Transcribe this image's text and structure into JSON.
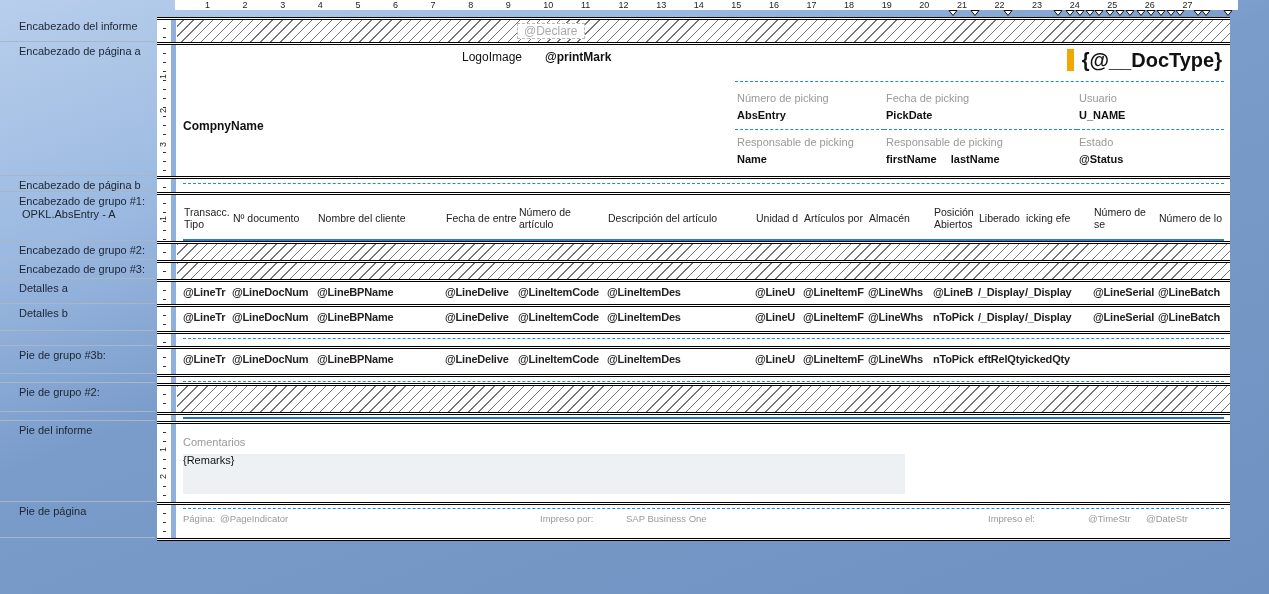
{
  "ruler": [
    "1",
    "2",
    "3",
    "4",
    "5",
    "6",
    "7",
    "8",
    "9",
    "10",
    "11",
    "12",
    "13",
    "14",
    "15",
    "16",
    "17",
    "18",
    "19",
    "20",
    "21",
    "22",
    "23",
    "24",
    "25",
    "26",
    "27"
  ],
  "sections": [
    {
      "label": "Encabezado del informe",
      "kind": "hatched",
      "field": "@Declare"
    },
    {
      "label": "Encabezado de página a",
      "kind": "page_header",
      "ruler": [
        "1",
        "2",
        "3"
      ],
      "logo": "LogoImage",
      "print_mark": "@printMark",
      "doc_type": "{@__DocType}",
      "company": "CompnyName",
      "info": [
        {
          "label": "Número de picking",
          "values": [
            "AbsEntry"
          ]
        },
        {
          "label": "Fecha de picking",
          "values": [
            "PickDate"
          ]
        },
        {
          "label": "Usuario",
          "values": [
            "U_NAME"
          ]
        },
        {
          "label": "Responsable de picking",
          "values": [
            "Name"
          ]
        },
        {
          "label": "Responsable de picking",
          "values": [
            "firstName",
            "lastName"
          ]
        },
        {
          "label": "Estado",
          "values": [
            "@Status"
          ]
        }
      ]
    },
    {
      "label": "Encabezado de página b",
      "kind": "dashed"
    },
    {
      "label": "Encabezado de grupo #1:",
      "sublabel": " OPKL.AbsEntry - A",
      "kind": "column_headers",
      "ruler": [
        "1"
      ],
      "cells": [
        "Transacc. Tipo",
        "Nº documento",
        "Nombre del cliente",
        "Fecha de entre",
        "Número de artículo",
        "Descripción del artículo",
        "Unidad d",
        "Artículos por",
        "Almacén",
        "Posición Abiertos",
        "Liberado",
        "icking efe",
        "Número de se",
        "Número de lo"
      ]
    },
    {
      "label": "Encabezado de grupo #2:",
      "kind": "hatched"
    },
    {
      "label": "Encabezado de grupo #3:",
      "kind": "hatched"
    },
    {
      "label": "Detalles a",
      "kind": "detail_row",
      "cells": [
        "@LineTr",
        "@LineDocNum",
        "@LineBPName",
        "@LineDelive",
        "@LineItemCode",
        "@LineItemDes",
        "@LineU",
        "@LineItemF",
        "@LineWhs",
        "@LineB",
        "/_Display",
        "/_Display",
        "@LineSerial",
        "@LineBatch"
      ]
    },
    {
      "label": "Detalles b",
      "kind": "detail_row",
      "cells": [
        "@LineTr",
        "@LineDocNum",
        "@LineBPName",
        "@LineDelive",
        "@LineItemCode",
        "@LineItemDes",
        "@LineU",
        "@LineItemF",
        "@LineWhs",
        "nToPick",
        "/_Display",
        "/_Display",
        "@LineSerial",
        "@LineBatch"
      ]
    },
    {
      "kind": "dashed"
    },
    {
      "label": "Pie de grupo #3b:",
      "kind": "detail_row",
      "cells": [
        "@LineTr",
        "@LineDocNum",
        "@LineBPName",
        "@LineDelive",
        "@LineItemCode",
        "@LineItemDes",
        "@LineU",
        "@LineItemF",
        "@LineWhs",
        "nToPick",
        "eftRelQty",
        "ickedQty"
      ]
    },
    {
      "kind": "dashed"
    },
    {
      "label": "Pie de grupo #2:",
      "kind": "hatched"
    },
    {
      "kind": "rule"
    },
    {
      "label": "Pie del informe",
      "kind": "remarks",
      "ruler": [
        "1",
        "2"
      ],
      "caption": "Comentarios",
      "field": "{Remarks}"
    },
    {
      "label": "Pie de página",
      "kind": "page_footer",
      "fields": [
        "Página:",
        "@PageIndicator",
        "Impreso por:",
        "SAP Business One",
        "Impreso el:",
        "@TimeStr",
        "@DateStr"
      ]
    }
  ]
}
